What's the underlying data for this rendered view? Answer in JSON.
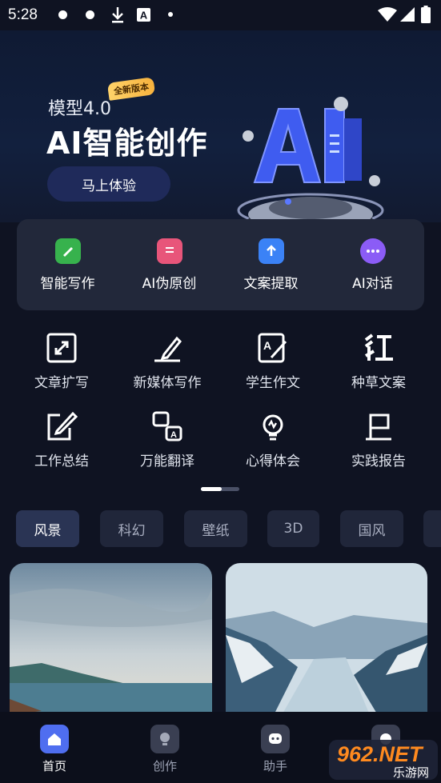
{
  "status_bar": {
    "time": "5:28"
  },
  "hero": {
    "subtitle": "模型4.0",
    "badge": "全新版本",
    "title": "AI智能创作",
    "cta_label": "马上体验"
  },
  "quick_tools": [
    {
      "label": "智能写作",
      "icon": "pen-note-icon",
      "color": "#37b24d"
    },
    {
      "label": "AI伪原创",
      "icon": "document-icon",
      "color": "#e8557a"
    },
    {
      "label": "文案提取",
      "icon": "upload-arrow-icon",
      "color": "#3b82f6"
    },
    {
      "label": "AI对话",
      "icon": "chat-bubble-icon",
      "color": "#8b5cf6"
    }
  ],
  "tools": [
    {
      "label": "文章扩写",
      "icon": "expand-icon"
    },
    {
      "label": "新媒体写作",
      "icon": "pen-signature-icon"
    },
    {
      "label": "学生作文",
      "icon": "essay-edit-icon"
    },
    {
      "label": "种草文案",
      "icon": "red-text-icon"
    },
    {
      "label": "工作总结",
      "icon": "edit-square-icon"
    },
    {
      "label": "万能翻译",
      "icon": "translate-icon"
    },
    {
      "label": "心得体会",
      "icon": "lightbulb-icon"
    },
    {
      "label": "实践报告",
      "icon": "scroll-flag-icon"
    }
  ],
  "categories": [
    "风景",
    "科幻",
    "壁纸",
    "3D",
    "国风"
  ],
  "active_category": "风景",
  "gallery": [
    {
      "alt": "sea-landscape"
    },
    {
      "alt": "fjord-landscape"
    }
  ],
  "bottom_nav": [
    {
      "label": "首页",
      "icon": "home-icon",
      "active": true
    },
    {
      "label": "创作",
      "icon": "lightbulb-icon",
      "active": false
    },
    {
      "label": "助手",
      "icon": "assistant-chat-icon",
      "active": false
    },
    {
      "label": "",
      "icon": "profile-icon",
      "active": false
    }
  ],
  "watermark": {
    "brand": "962.NET",
    "sub": "乐游网"
  }
}
